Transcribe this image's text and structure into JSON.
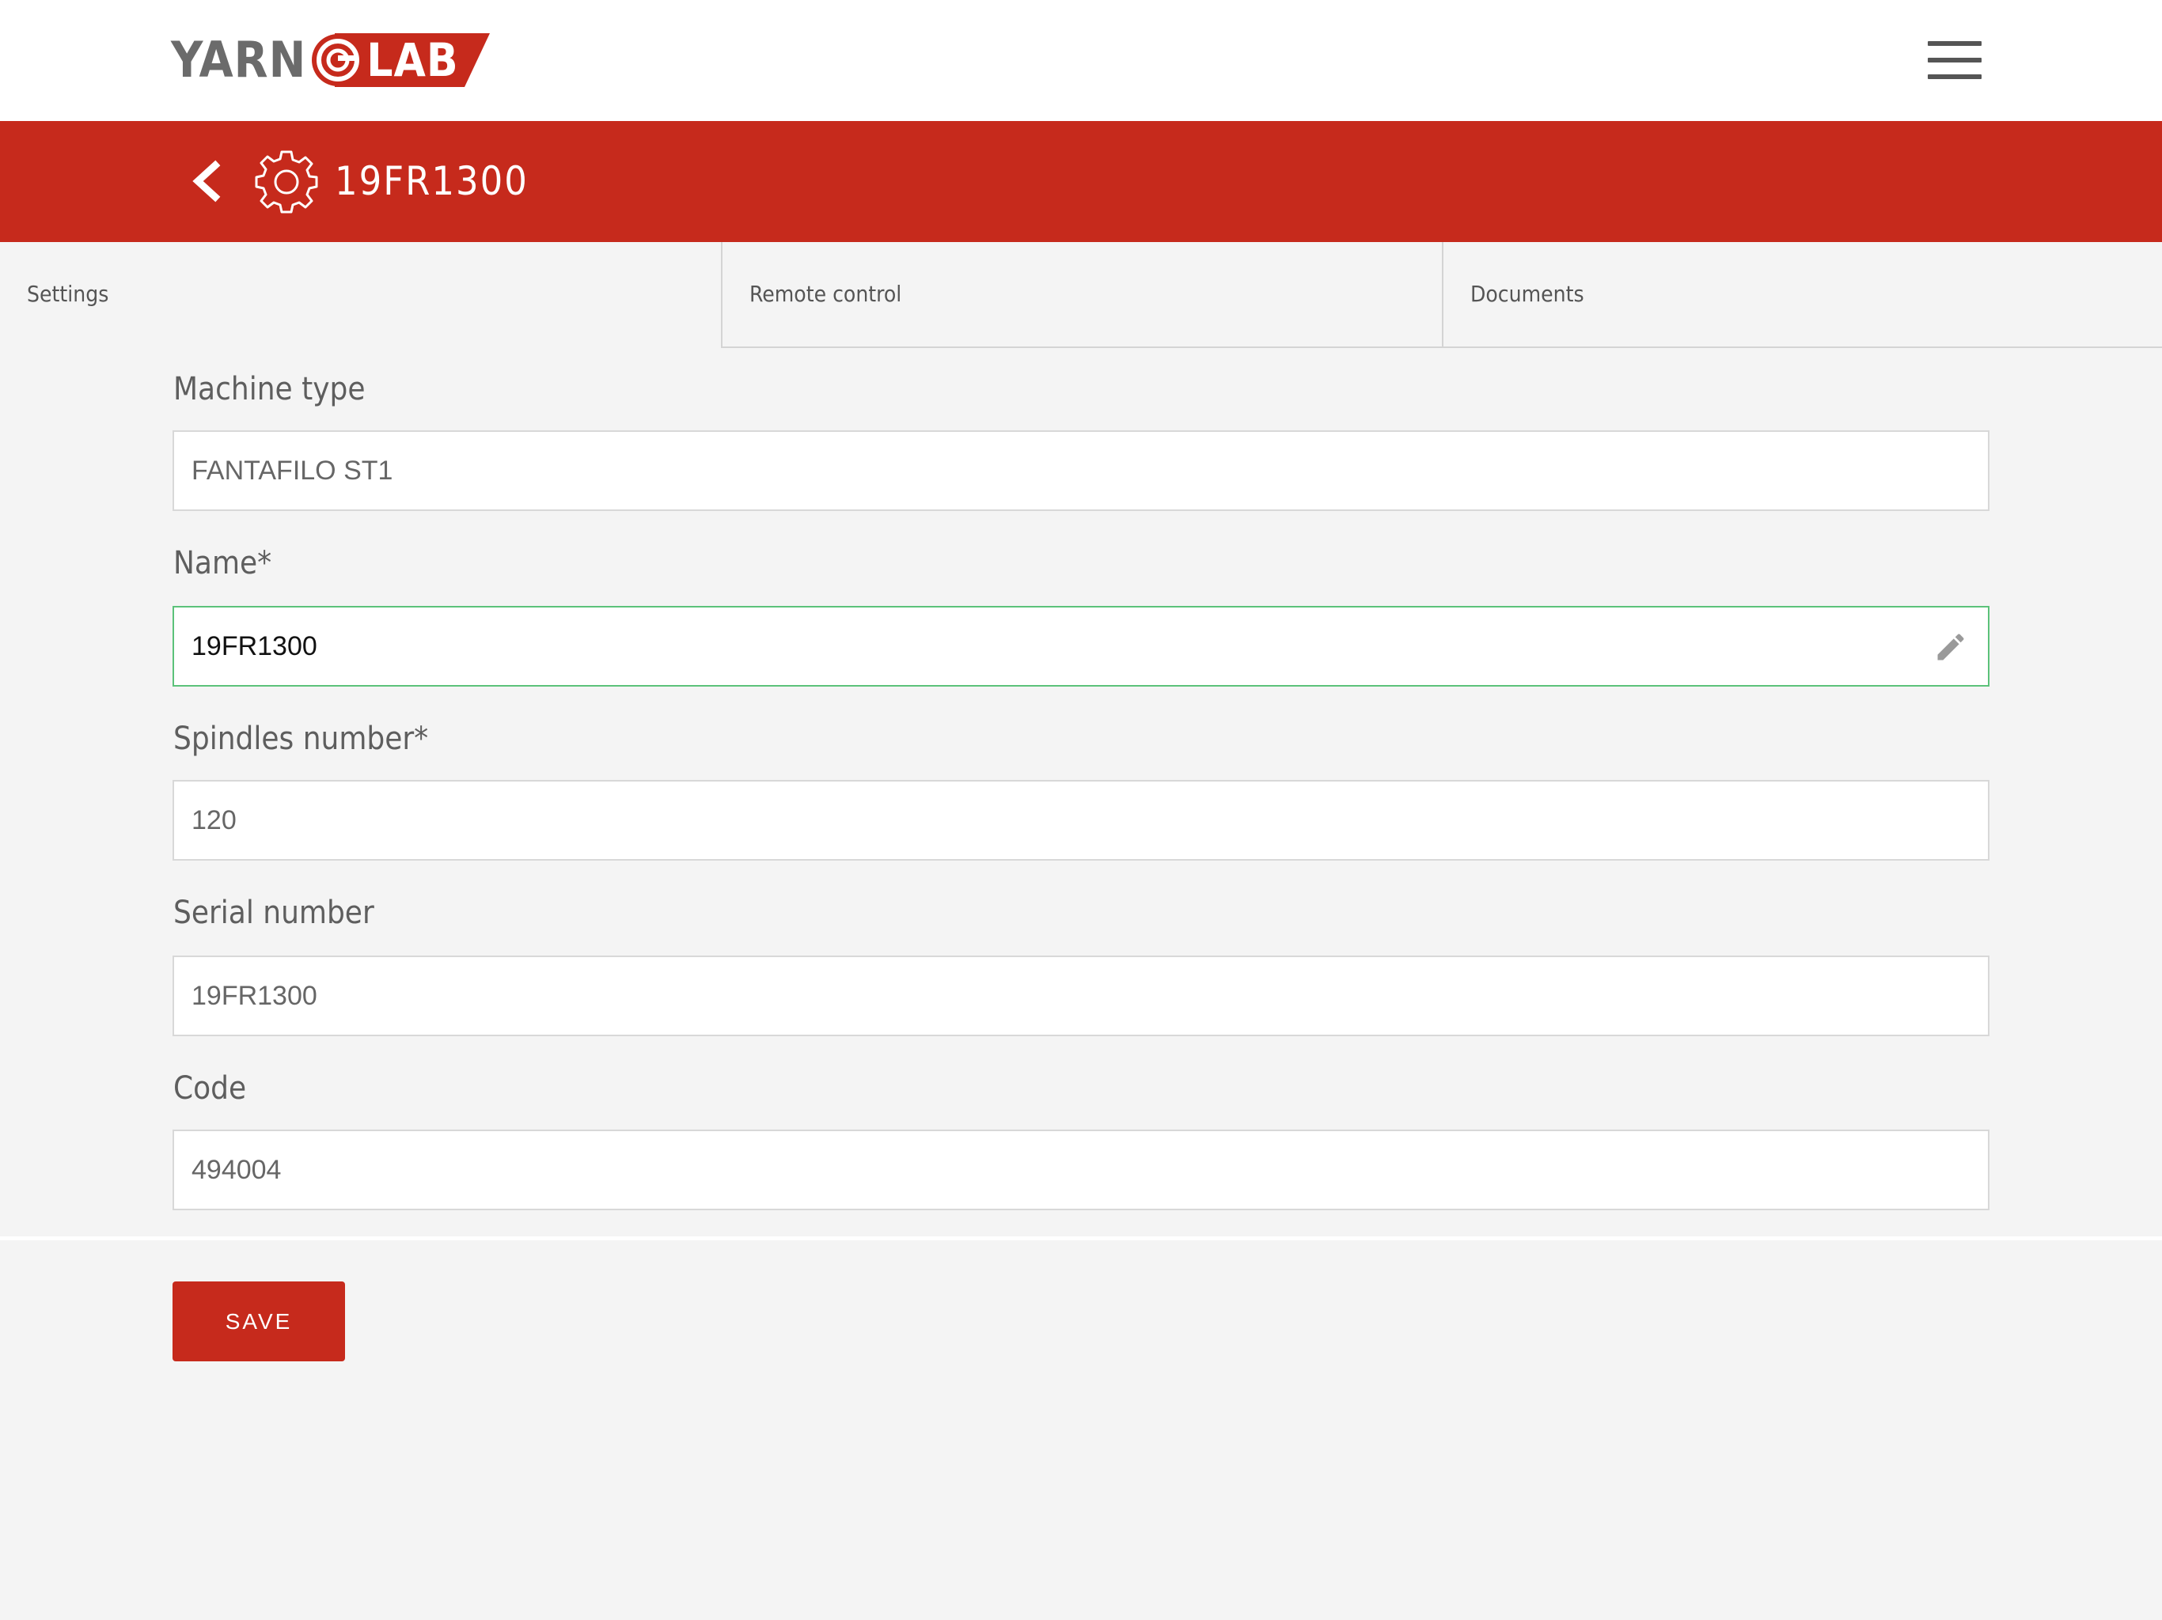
{
  "header": {
    "logo_left": "YARN",
    "logo_right": "LAB",
    "menu_icon": "hamburger-menu-icon"
  },
  "title_bar": {
    "back_icon": "chevron-left-icon",
    "machine_icon": "gear-icon",
    "title": "19FR1300"
  },
  "tabs": [
    {
      "label": "Settings",
      "active": true
    },
    {
      "label": "Remote control",
      "active": false
    },
    {
      "label": "Documents",
      "active": false
    }
  ],
  "form": {
    "machine_type": {
      "label": "Machine type",
      "value": "FANTAFILO ST1"
    },
    "name": {
      "label": "Name*",
      "value": "19FR1300",
      "edit_icon": "pencil-icon"
    },
    "spindles": {
      "label": "Spindles number*",
      "value": "120"
    },
    "serial": {
      "label": "Serial number",
      "value": "19FR1300"
    },
    "code": {
      "label": "Code",
      "value": "494004"
    }
  },
  "actions": {
    "save_label": "SAVE"
  },
  "colors": {
    "accent": "#c62a1c",
    "focus_border": "#5cc27a",
    "background": "#f4f4f4"
  }
}
